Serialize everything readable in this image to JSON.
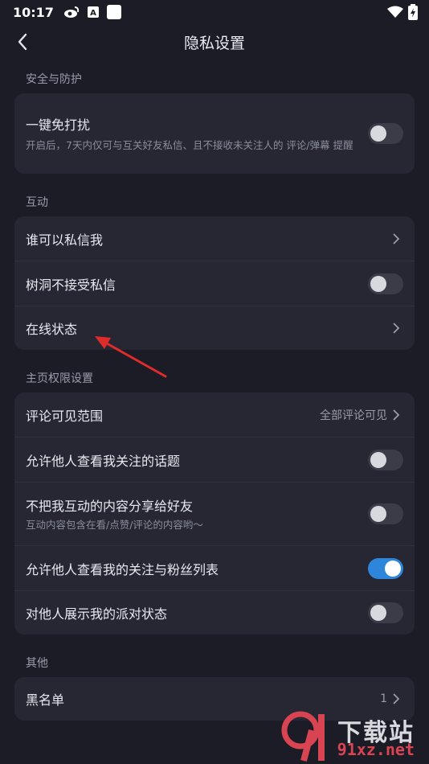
{
  "status_bar": {
    "time": "10:17",
    "left_icons": [
      "weibo-icon",
      "notification-a-icon",
      "square-notification-icon"
    ],
    "right_icons": [
      "wifi-icon",
      "battery-charging-icon"
    ]
  },
  "header": {
    "title": "隐私设置"
  },
  "sections": {
    "security": {
      "label": "安全与防护",
      "items": [
        {
          "title": "一键免打扰",
          "subtitle": "开启后，7天内仅可与互关好友私信、且不接收未关注人的 评论/弹幕 提醒",
          "toggle": false
        }
      ]
    },
    "interaction": {
      "label": "互动",
      "items": [
        {
          "title": "谁可以私信我",
          "control": "chevron"
        },
        {
          "title": "树洞不接受私信",
          "toggle": false
        },
        {
          "title": "在线状态",
          "control": "chevron"
        }
      ]
    },
    "homepage": {
      "label": "主页权限设置",
      "items": [
        {
          "title": "评论可见范围",
          "value": "全部评论可见",
          "control": "chevron"
        },
        {
          "title": "允许他人查看我关注的话题",
          "toggle": false
        },
        {
          "title": "不把我互动的内容分享给好友",
          "subtitle": "互动内容包含在看/点赞/评论的内容哟～",
          "toggle": false
        },
        {
          "title": "允许他人查看我的关注与粉丝列表",
          "toggle": true
        },
        {
          "title": "对他人展示我的派对状态",
          "toggle": false
        }
      ]
    },
    "other": {
      "label": "其他",
      "items": [
        {
          "title": "黑名单",
          "value": "1",
          "control": "chevron"
        }
      ]
    }
  },
  "watermark": {
    "cn": "下载站",
    "site": "91xz.net",
    "logo": "91"
  },
  "colors": {
    "background": "#1b1c26",
    "card": "#262733",
    "toggle_on": "#2d86d9",
    "annotation_arrow": "#e02b2b"
  }
}
